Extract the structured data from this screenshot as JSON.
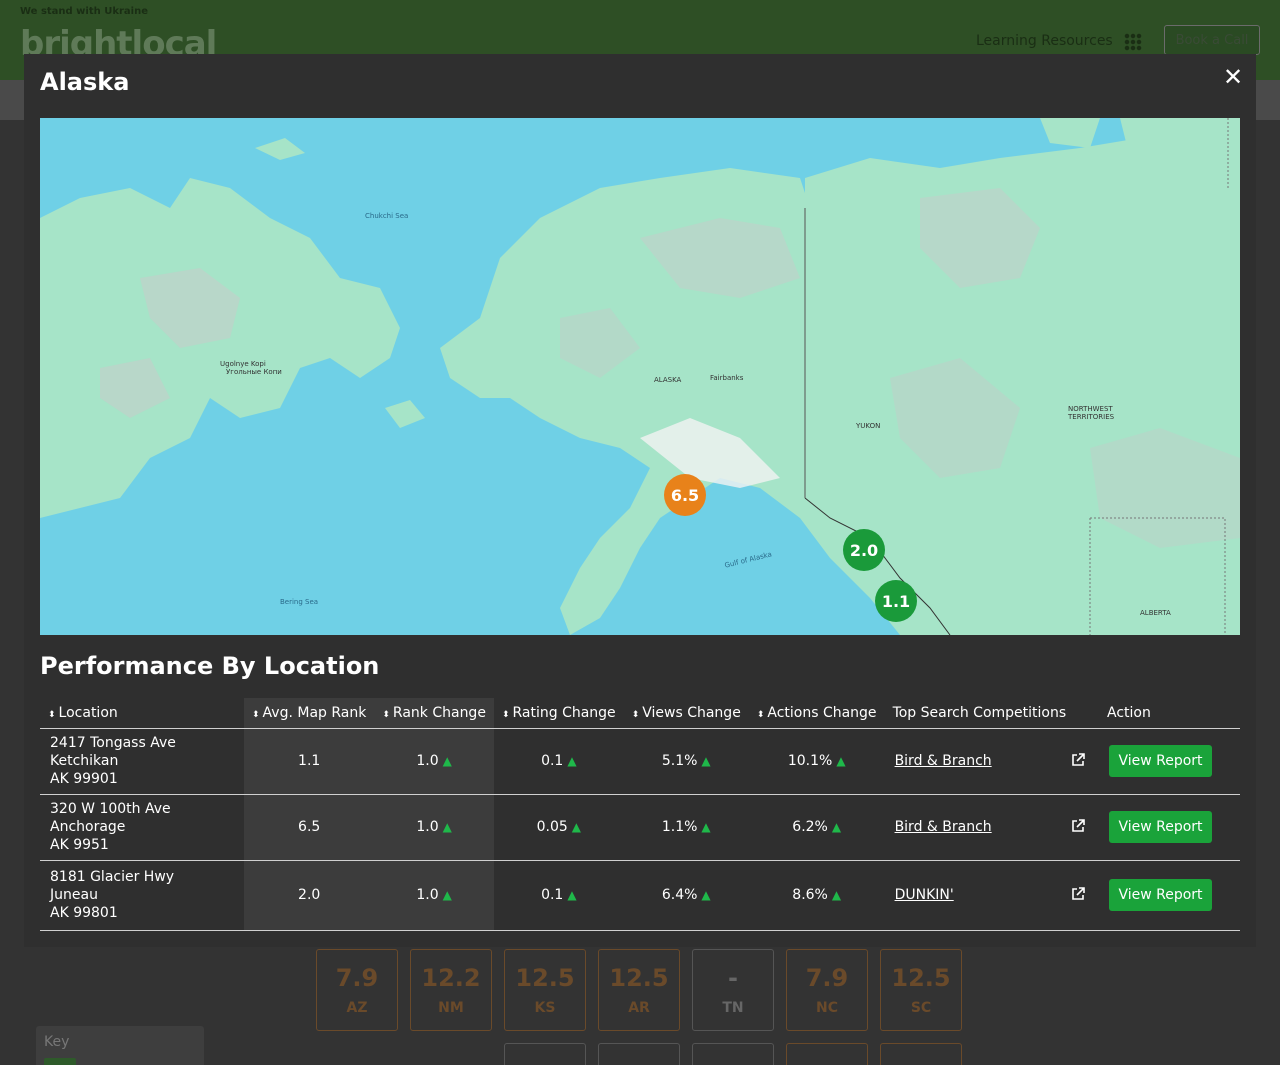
{
  "background": {
    "banner_text": "We stand with Ukraine",
    "logo_text": "brightlocal",
    "learning_resources": "Learning Resources",
    "book_call": "Book a Call",
    "key_label": "Key",
    "tiles": [
      {
        "value": "7.9",
        "state": "AZ"
      },
      {
        "value": "12.2",
        "state": "NM"
      },
      {
        "value": "12.5",
        "state": "KS"
      },
      {
        "value": "12.5",
        "state": "AR"
      },
      {
        "value": "-",
        "state": "TN"
      },
      {
        "value": "7.9",
        "state": "NC"
      },
      {
        "value": "12.5",
        "state": "SC"
      }
    ]
  },
  "modal": {
    "title": "Alaska",
    "close_icon": "close-icon",
    "map": {
      "labels": {
        "chukchi": "Chukchi Sea",
        "ugolnye": "Ugolnye Kopi",
        "ugolnye_ru": "Угольные Копи",
        "alaska": "ALASKA",
        "fairbanks": "Fairbanks",
        "yukon": "YUKON",
        "nwt": "NORTHWEST TERRITORIES",
        "gulf": "Gulf of Alaska",
        "bering": "Bering Sea",
        "alberta": "ALBERTA"
      },
      "markers": [
        {
          "value": "6.5",
          "color": "#e8821a"
        },
        {
          "value": "2.0",
          "color": "#1a9a3a"
        },
        {
          "value": "1.1",
          "color": "#1a9a3a"
        }
      ]
    },
    "section_title": "Performance By Location",
    "table": {
      "headers": {
        "location": "Location",
        "avg_rank": "Avg. Map Rank",
        "rank_change": "Rank Change",
        "rating_change": "Rating Change",
        "views_change": "Views Change",
        "actions_change": "Actions Change",
        "top_search": "Top Search Competitions",
        "action": "Action"
      },
      "rows": [
        {
          "address1": "2417 Tongass Ave",
          "address2": "Ketchikan",
          "address3": "AK 99901",
          "avg_rank": "1.1",
          "rank_change": "1.0",
          "rating_change": "0.1",
          "views_change": "5.1%",
          "actions_change": "10.1%",
          "competitor": "Bird & Branch",
          "button": "View Report"
        },
        {
          "address1": "320 W 100th Ave",
          "address2": "Anchorage",
          "address3": "AK 9951",
          "avg_rank": "6.5",
          "rank_change": "1.0",
          "rating_change": "0.05",
          "views_change": "1.1%",
          "actions_change": "6.2%",
          "competitor": "Bird & Branch",
          "button": "View Report"
        },
        {
          "address1": "8181 Glacier Hwy",
          "address2": "Juneau",
          "address3": "AK 99801",
          "avg_rank": "2.0",
          "rank_change": "1.0",
          "rating_change": "0.1",
          "views_change": "6.4%",
          "actions_change": "8.6%",
          "competitor": "DUNKIN'",
          "button": "View Report"
        }
      ]
    }
  }
}
